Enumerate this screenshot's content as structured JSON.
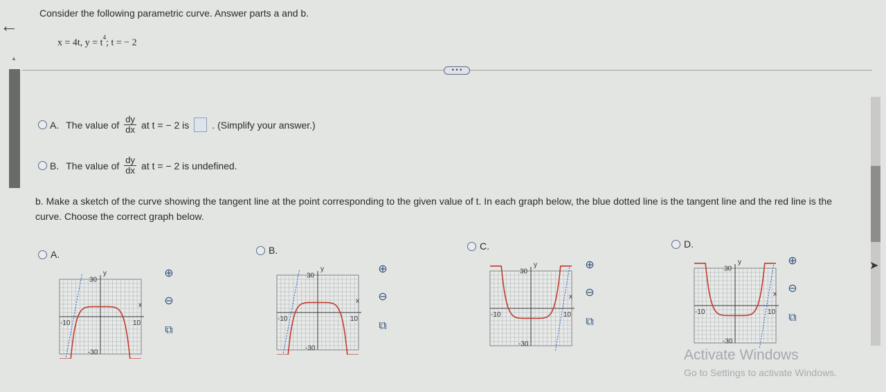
{
  "nav": {
    "back_glyph": "←"
  },
  "question": {
    "prompt": "Consider the following parametric curve. Answer parts a and b.",
    "equation_pre": "x = 4t, y = t",
    "equation_exp": "4",
    "equation_post": "; t = − 2"
  },
  "more_button": "• • •",
  "part_a": {
    "option_a": {
      "letter": "A.",
      "prefix": "The value of",
      "frac_num": "dy",
      "frac_den": "dx",
      "middle": "at t = − 2 is",
      "suffix": ". (Simplify your answer.)"
    },
    "option_b": {
      "letter": "B.",
      "prefix": "The value of",
      "frac_num": "dy",
      "frac_den": "dx",
      "suffix": "at t = − 2 is undefined."
    }
  },
  "part_b": {
    "text": "b. Make a sketch of the curve showing the tangent line at the point corresponding to the given value of t. In each graph below, the blue dotted line is the tangent line and the red line is the curve. Choose the correct graph below."
  },
  "graphs": [
    {
      "letter": "A.",
      "shape": "down",
      "y_top": "30",
      "y_bottom": "-30",
      "x_left": "-10",
      "x_right": "10",
      "x_axis": "x",
      "y_axis": "y"
    },
    {
      "letter": "B.",
      "shape": "down",
      "y_top": "30",
      "y_bottom": "-30",
      "x_left": "-10",
      "x_right": "10",
      "x_axis": "x",
      "y_axis": "y"
    },
    {
      "letter": "C.",
      "shape": "up",
      "y_top": "30",
      "y_bottom": "-30",
      "x_left": "-10",
      "x_right": "10",
      "x_axis": "x",
      "y_axis": "y"
    },
    {
      "letter": "D.",
      "shape": "up",
      "y_top": "30",
      "y_bottom": "-30",
      "x_left": "-10",
      "x_right": "10",
      "x_axis": "x",
      "y_axis": "y"
    }
  ],
  "tools": {
    "zoom_in": "⊕",
    "zoom_out": "⊖",
    "popout": "⧉"
  },
  "colors": {
    "curve": "#c0392b",
    "tangent": "#2a62c9",
    "grid": "#a9adb3",
    "accent": "#5d6b84"
  },
  "watermark": {
    "title": "Activate Windows",
    "subtitle": "Go to Settings to activate Windows."
  }
}
